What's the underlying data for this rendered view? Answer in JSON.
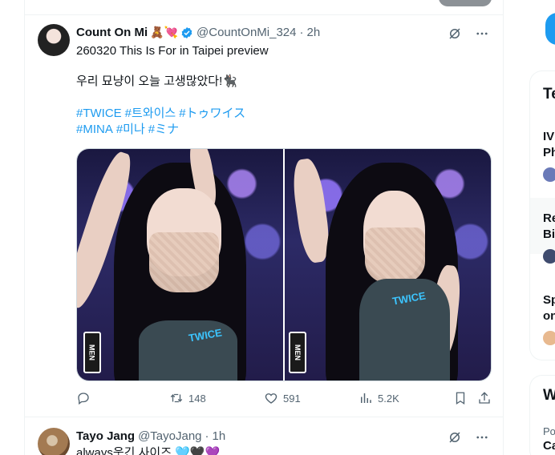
{
  "tweet1": {
    "name": "Count On Mi",
    "emojis": "🧸💘",
    "handle": "@CountOnMi_324",
    "dot": "·",
    "time": "2h",
    "line1": "260320 This Is For in Taipei preview",
    "line2": "우리 묘냥이 오늘 고생많았다!🐈‍⬛",
    "tags_row1": [
      "#TWICE",
      "#트와이스",
      "#トゥワイス"
    ],
    "tags_row2": [
      "#MINA",
      "#미나",
      "#ミナ"
    ],
    "media": {
      "photo1_badge": "MEN",
      "photo1_print": "TWICE",
      "photo2_badge": "MEN",
      "photo2_print": "TWICE"
    },
    "actions": {
      "replies": "",
      "retweets": "148",
      "likes": "591",
      "views": "5.2K"
    }
  },
  "tweet2": {
    "name": "Tayo Jang",
    "handle": "@TayoJang",
    "dot": "·",
    "time": "1h",
    "line1": "always웃긴 사이즈 🩵🖤💜"
  },
  "sidebar": {
    "card1_title": "Te",
    "trend1_line1": "IV",
    "trend1_line2": "Ph",
    "trend2_line1": "Re",
    "trend2_line2": "Bi",
    "trend3_line1": "Sp",
    "trend3_line2": "on",
    "card2_title": "W",
    "card2_sub": "Po",
    "card2_name": "Ca"
  },
  "colors": {
    "accent": "#1d9bf0",
    "muted": "#536471",
    "text": "#0f1419"
  }
}
